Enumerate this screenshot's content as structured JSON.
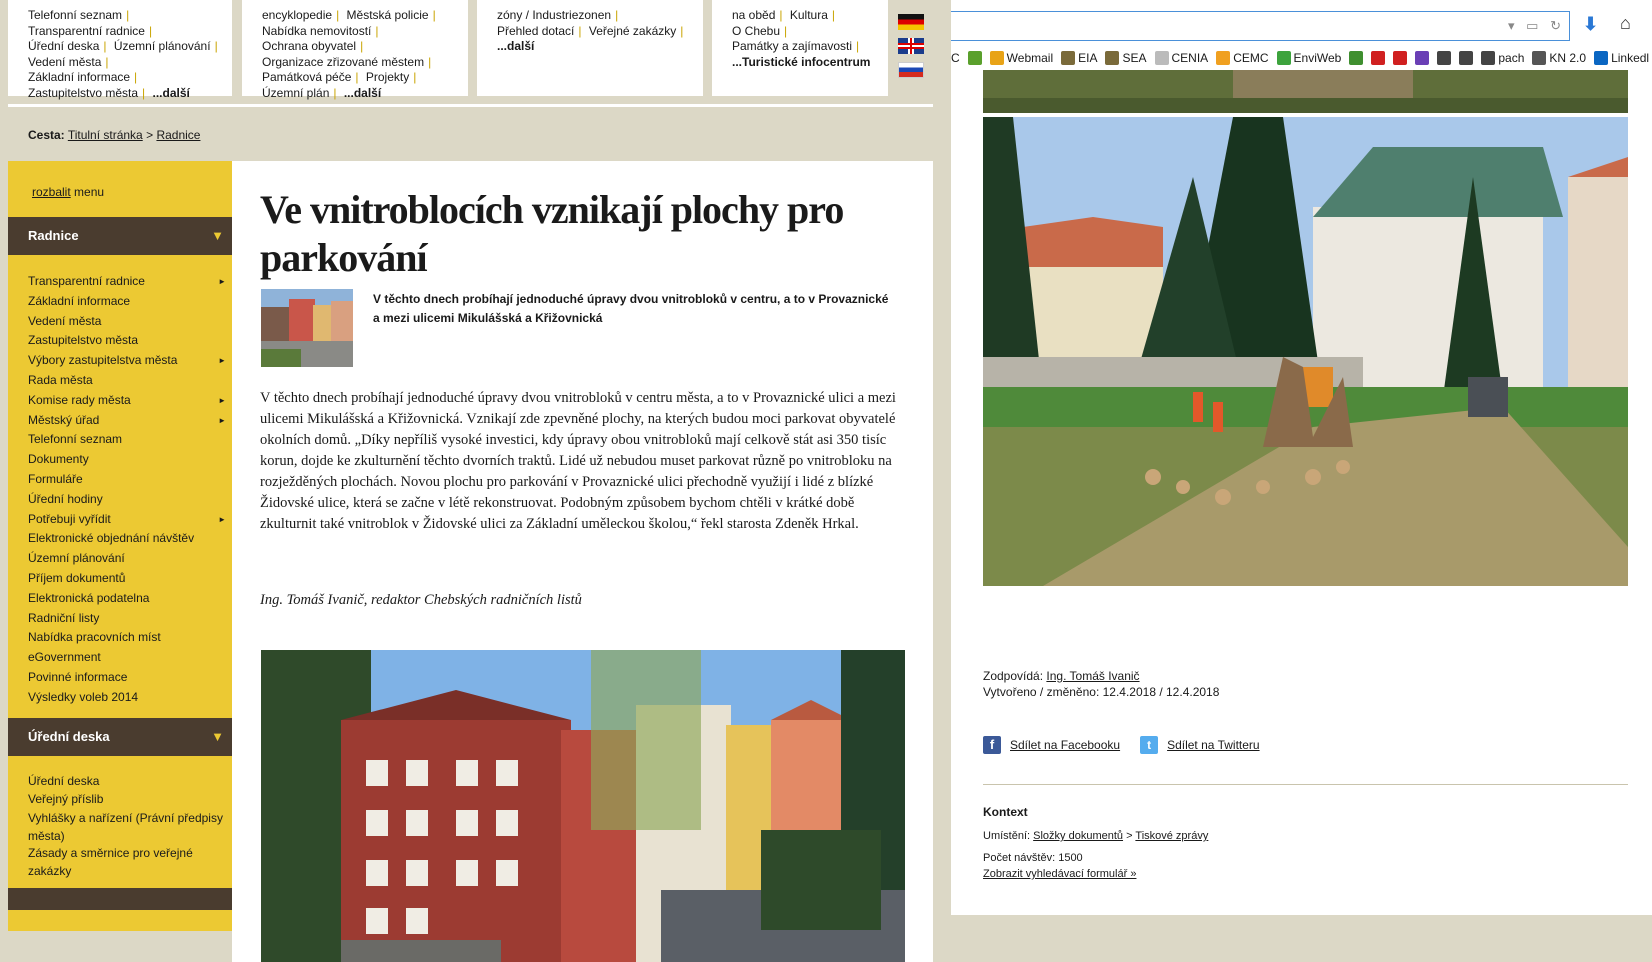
{
  "top_boxes": {
    "box1": [
      "Telefonní seznam",
      "Transparentní radnice",
      "Úřední deska",
      "Územní plánování",
      "Vedení města",
      "Základní informace",
      "Zastupitelstvo města",
      "...další"
    ],
    "box2": [
      "encyklopedie",
      "Městská policie",
      "Nabídka nemovitostí",
      "Ochrana obyvatel",
      "Organizace zřizované městem",
      "Památková péče",
      "Projekty",
      "Územní plán",
      "...další"
    ],
    "box3": [
      "zóny / Industriezonen",
      "Přehled dotací",
      "Veřejné zakázky",
      "...další"
    ],
    "box4": [
      "na oběd",
      "Kultura",
      "O Chebu",
      "Památky a zajímavosti",
      "...Turistické infocentrum"
    ]
  },
  "breadcrumb": {
    "label": "Cesta:",
    "home": "Titulní stránka",
    "sep": ">",
    "current": "Radnice"
  },
  "sidebar": {
    "toggle_link": "rozbalit",
    "toggle_rest": " menu",
    "section1": "Radnice",
    "section1_items": [
      {
        "label": "Transparentní radnice",
        "sub": true
      },
      {
        "label": "Základní informace",
        "sub": false
      },
      {
        "label": "Vedení města",
        "sub": false
      },
      {
        "label": "Zastupitelstvo města",
        "sub": false
      },
      {
        "label": "Výbory zastupitelstva města",
        "sub": true
      },
      {
        "label": "Rada města",
        "sub": false
      },
      {
        "label": "Komise rady města",
        "sub": true
      },
      {
        "label": "Městský úřad",
        "sub": true
      },
      {
        "label": "Telefonní seznam",
        "sub": false
      },
      {
        "label": "Dokumenty",
        "sub": false
      },
      {
        "label": "Formuláře",
        "sub": false
      },
      {
        "label": "Úřední hodiny",
        "sub": false
      },
      {
        "label": "Potřebuji vyřídit",
        "sub": true
      },
      {
        "label": "Elektronické objednání návštěv",
        "sub": false
      },
      {
        "label": "Územní plánování",
        "sub": false
      },
      {
        "label": "Příjem dokumentů",
        "sub": false
      },
      {
        "label": "Elektronická podatelna",
        "sub": false
      },
      {
        "label": "Radniční listy",
        "sub": false
      },
      {
        "label": "Nabídka pracovních míst",
        "sub": false
      },
      {
        "label": "eGovernment",
        "sub": false
      },
      {
        "label": "Povinné informace",
        "sub": false
      },
      {
        "label": "Výsledky voleb 2014",
        "sub": false
      }
    ],
    "section2": "Úřední deska",
    "section2_items": [
      "Úřední deska",
      "Veřejný příslib",
      "Vyhlášky a nařízení (Právní předpisy města)",
      "Zásady a směrnice pro veřejné zakázky"
    ],
    "arrow": "▼",
    "sub_arrow": "►"
  },
  "article": {
    "title": "Ve vnitroblocích vznikají plochy pro parkování",
    "perex": "V těchto dnech probíhají jednoduché úpravy dvou vnitrobloků v centru, a to v Provaznické a mezi ulicemi Mikulášská a Křižovnická",
    "body": "V těchto dnech probíhají jednoduché úpravy dvou vnitrobloků v centru města, a to v Provaznické ulici a mezi ulicemi Mikulášská a Křižovnická. Vznikají zde zpevněné plochy, na kterých budou moci parkovat obyvatelé okolních domů. „Díky nepříliš vysoké investici, kdy úpravy obou vnitrobloků mají celkově stát asi 350 tisíc korun, dojde ke zkulturnění těchto dvorních traktů. Lidé už nebudou muset parkovat různě po vnitrobloku na rozježděných plochách. Novou plochu pro parkování v Provaznické ulici přechodně využijí i lidé z blízké Židovské ulice, která se začne v létě rekonstruovat. Podobným způsobem bychom chtěli v krátké době zkulturnit také vnitroblok v Židovské ulici za Základní uměleckou školou,“ řekl starosta Zdeněk Hrkal.",
    "author": "Ing. Tomáš Ivanič, redaktor Chebských radničních listů"
  },
  "browser": {
    "bookmarks": [
      {
        "label": "C",
        "icon": "partial-icon",
        "color": "#ffffff"
      },
      {
        "label": "",
        "icon": "leaf-icon",
        "color": "#5aa02c"
      },
      {
        "label": "Webmail",
        "icon": "mail-icon",
        "color": "#e8a317"
      },
      {
        "label": "EIA",
        "icon": "doc-icon",
        "color": "#7a6a3a"
      },
      {
        "label": "SEA",
        "icon": "doc-icon",
        "color": "#7a6a3a"
      },
      {
        "label": "CENIA",
        "icon": "dot-icon",
        "color": "#bbbbbb"
      },
      {
        "label": "CEMC",
        "icon": "cemc-icon",
        "color": "#f0a020"
      },
      {
        "label": "EnviWeb",
        "icon": "euro-icon",
        "color": "#3da33d"
      },
      {
        "label": "",
        "icon": "diamond-icon",
        "color": "#3f8f2f"
      },
      {
        "label": "",
        "icon": "red-icon",
        "color": "#d02020"
      },
      {
        "label": "",
        "icon": "alpha-icon",
        "color": "#d02020"
      },
      {
        "label": "",
        "icon": "iy-icon",
        "color": "#6a3fb5"
      },
      {
        "label": "",
        "icon": "globe-icon",
        "color": "#444444"
      },
      {
        "label": "",
        "icon": "paw-icon",
        "color": "#444444"
      },
      {
        "label": "pach",
        "icon": "globe-icon",
        "color": "#444444"
      },
      {
        "label": "KN 2.0",
        "icon": "kn-icon",
        "color": "#555555"
      },
      {
        "label": "Linkedl",
        "icon": "linkedin-icon",
        "color": "#0a66c2"
      }
    ]
  },
  "meta": {
    "resp_label": "Zodpovídá:",
    "resp_name": "Ing. Tomáš Ivanič",
    "created": "Vytvořeno / změněno: 12.4.2018 / 12.4.2018",
    "share_fb": "Sdílet na Facebooku",
    "share_tw": "Sdílet na Twitteru",
    "context_head": "Kontext",
    "location_label": "Umístění:",
    "location_1": "Složky dokumentů",
    "location_sep": ">",
    "location_2": "Tiskové zprávy",
    "visits": "Počet návštěv: 1500",
    "search_form": "Zobrazit vyhledávací formulář »"
  }
}
